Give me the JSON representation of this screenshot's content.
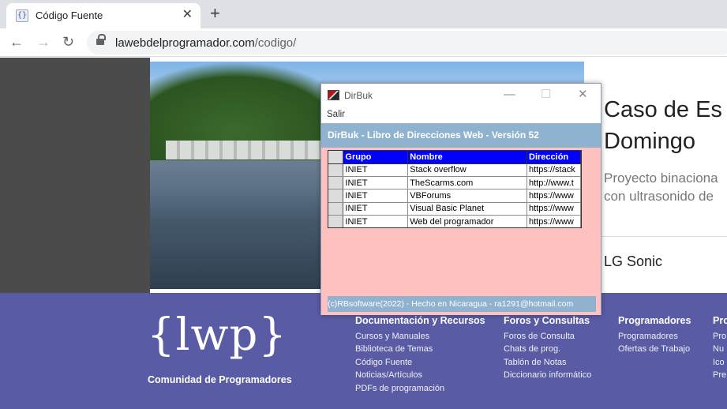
{
  "browser": {
    "tab_favicon": "{}",
    "tab_title": "Código Fuente",
    "tab_close": "✕",
    "new_tab": "+",
    "back": "←",
    "forward": "→",
    "reload": "↻",
    "url_domain": "lawebdelprogramador.com",
    "url_path": "/codigo/"
  },
  "hero": {
    "title_line1": "Caso de Es",
    "title_line2": "Domingo",
    "subtitle_line1": "Proyecto binaciona",
    "subtitle_line2": "con ultrasonido de",
    "company": "LG Sonic"
  },
  "footer": {
    "logo": "{lwp}",
    "logo_caption": "Comunidad de Programadores",
    "columns": [
      {
        "heading": "Documentación y Recursos",
        "items": [
          "Cursos y Manuales",
          "Biblioteca de Temas",
          "Código Fuente",
          "Noticias/Artículos",
          "PDFs de programación"
        ]
      },
      {
        "heading": "Foros y Consultas",
        "items": [
          "Foros de Consulta",
          "Chats de prog.",
          "Tablón de Notas",
          "Diccionario informático"
        ]
      },
      {
        "heading": "Programadores",
        "items": [
          "Programadores",
          "Ofertas de Trabajo"
        ]
      },
      {
        "heading": "Pro",
        "items": [
          "Pro",
          "Nu",
          "Ico",
          "Pre"
        ]
      }
    ]
  },
  "dirbuk": {
    "title": "DirBuk",
    "minimize": "—",
    "maximize": "☐",
    "close": "✕",
    "menu_salir": "Salir",
    "header": "DirBuk - Libro de Direcciones Web - Versión 52",
    "columns": [
      "Grupo",
      "Nombre",
      "Dirección"
    ],
    "rows": [
      [
        "INIET",
        "Stack overflow",
        "https://stack"
      ],
      [
        "INIET",
        "TheScarms.com",
        "http://www.t"
      ],
      [
        "INIET",
        "VBForums",
        "https://www"
      ],
      [
        "INIET",
        "Visual Basic Planet",
        "https://www"
      ],
      [
        "INIET",
        "Web del programador",
        "https://www"
      ]
    ],
    "status": "(c)RBsoftware(2022) - Hecho en Nicaragua - ra1291@hotmail.com"
  }
}
